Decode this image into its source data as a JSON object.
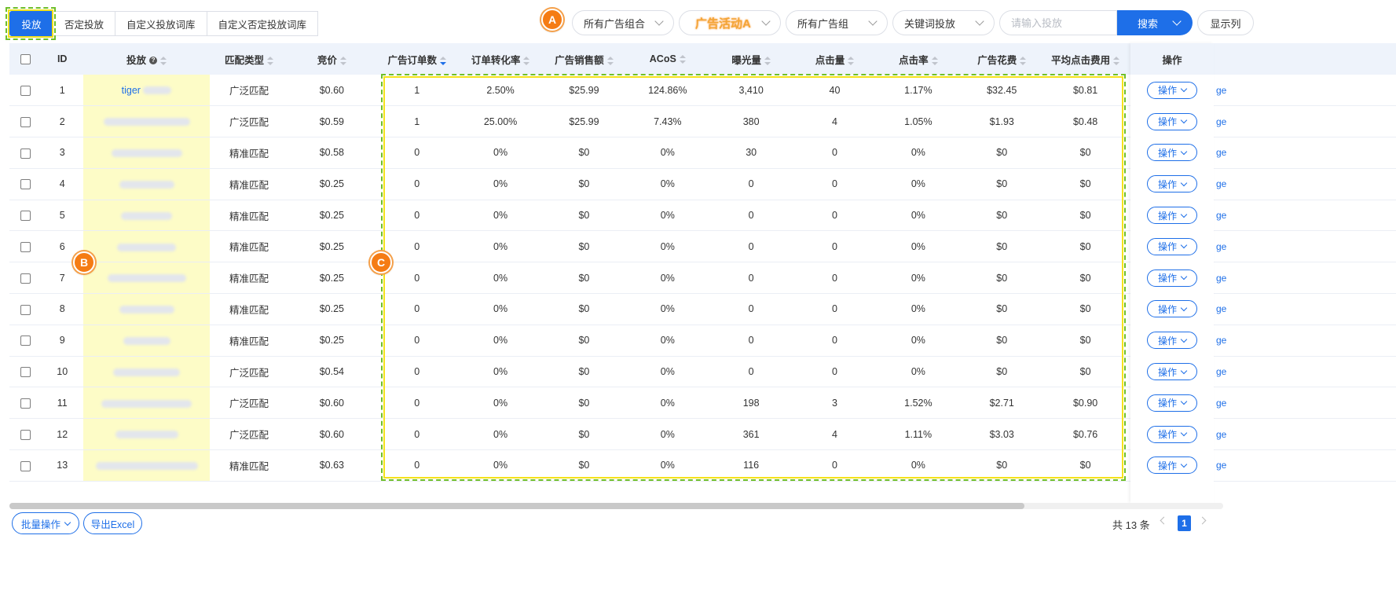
{
  "tabs": [
    {
      "label": "投放",
      "active": true
    },
    {
      "label": "否定投放",
      "active": false
    },
    {
      "label": "自定义投放词库",
      "active": false
    },
    {
      "label": "自定义否定投放词库",
      "active": false
    }
  ],
  "filters": {
    "portfolio": "所有广告组合",
    "campaign": "广告活动A",
    "ad_group": "所有广告组",
    "targeting_type": "关键词投放",
    "search_placeholder": "请输入投放",
    "search_label": "搜索",
    "columns_label": "显示列"
  },
  "markers": {
    "a": "A",
    "b": "B",
    "c": "C"
  },
  "columns": {
    "id": "ID",
    "target": "投放",
    "match_type": "匹配类型",
    "bid": "竞价",
    "orders": "广告订单数",
    "cvr": "订单转化率",
    "sales": "广告销售额",
    "acos": "ACoS",
    "impressions": "曝光量",
    "clicks": "点击量",
    "ctr": "点击率",
    "spend": "广告花费",
    "cpc": "平均点击费用",
    "actions": "操作"
  },
  "rows": [
    {
      "id": "1",
      "keyword": "tiger",
      "match": "广泛匹配",
      "bid": "$0.60",
      "orders": "1",
      "cvr": "2.50%",
      "sales": "$25.99",
      "acos": "124.86%",
      "impressions": "3,410",
      "clicks": "40",
      "ctr": "1.17%",
      "spend": "$32.45",
      "cpc": "$0.81"
    },
    {
      "id": "2",
      "keyword": "",
      "match": "广泛匹配",
      "bid": "$0.59",
      "orders": "1",
      "cvr": "25.00%",
      "sales": "$25.99",
      "acos": "7.43%",
      "impressions": "380",
      "clicks": "4",
      "ctr": "1.05%",
      "spend": "$1.93",
      "cpc": "$0.48"
    },
    {
      "id": "3",
      "keyword": "",
      "match": "精准匹配",
      "bid": "$0.58",
      "orders": "0",
      "cvr": "0%",
      "sales": "$0",
      "acos": "0%",
      "impressions": "30",
      "clicks": "0",
      "ctr": "0%",
      "spend": "$0",
      "cpc": "$0"
    },
    {
      "id": "4",
      "keyword": "",
      "match": "精准匹配",
      "bid": "$0.25",
      "orders": "0",
      "cvr": "0%",
      "sales": "$0",
      "acos": "0%",
      "impressions": "0",
      "clicks": "0",
      "ctr": "0%",
      "spend": "$0",
      "cpc": "$0"
    },
    {
      "id": "5",
      "keyword": "",
      "match": "精准匹配",
      "bid": "$0.25",
      "orders": "0",
      "cvr": "0%",
      "sales": "$0",
      "acos": "0%",
      "impressions": "0",
      "clicks": "0",
      "ctr": "0%",
      "spend": "$0",
      "cpc": "$0"
    },
    {
      "id": "6",
      "keyword": "",
      "match": "精准匹配",
      "bid": "$0.25",
      "orders": "0",
      "cvr": "0%",
      "sales": "$0",
      "acos": "0%",
      "impressions": "0",
      "clicks": "0",
      "ctr": "0%",
      "spend": "$0",
      "cpc": "$0"
    },
    {
      "id": "7",
      "keyword": "",
      "match": "精准匹配",
      "bid": "$0.25",
      "orders": "0",
      "cvr": "0%",
      "sales": "$0",
      "acos": "0%",
      "impressions": "0",
      "clicks": "0",
      "ctr": "0%",
      "spend": "$0",
      "cpc": "$0"
    },
    {
      "id": "8",
      "keyword": "",
      "match": "精准匹配",
      "bid": "$0.25",
      "orders": "0",
      "cvr": "0%",
      "sales": "$0",
      "acos": "0%",
      "impressions": "0",
      "clicks": "0",
      "ctr": "0%",
      "spend": "$0",
      "cpc": "$0"
    },
    {
      "id": "9",
      "keyword": "",
      "match": "精准匹配",
      "bid": "$0.25",
      "orders": "0",
      "cvr": "0%",
      "sales": "$0",
      "acos": "0%",
      "impressions": "0",
      "clicks": "0",
      "ctr": "0%",
      "spend": "$0",
      "cpc": "$0"
    },
    {
      "id": "10",
      "keyword": "",
      "match": "广泛匹配",
      "bid": "$0.54",
      "orders": "0",
      "cvr": "0%",
      "sales": "$0",
      "acos": "0%",
      "impressions": "0",
      "clicks": "0",
      "ctr": "0%",
      "spend": "$0",
      "cpc": "$0"
    },
    {
      "id": "11",
      "keyword": "",
      "match": "广泛匹配",
      "bid": "$0.60",
      "orders": "0",
      "cvr": "0%",
      "sales": "$0",
      "acos": "0%",
      "impressions": "198",
      "clicks": "3",
      "ctr": "1.52%",
      "spend": "$2.71",
      "cpc": "$0.90"
    },
    {
      "id": "12",
      "keyword": "",
      "match": "广泛匹配",
      "bid": "$0.60",
      "orders": "0",
      "cvr": "0%",
      "sales": "$0",
      "acos": "0%",
      "impressions": "361",
      "clicks": "4",
      "ctr": "1.11%",
      "spend": "$3.03",
      "cpc": "$0.76"
    },
    {
      "id": "13",
      "keyword": "",
      "match": "精准匹配",
      "bid": "$0.63",
      "orders": "0",
      "cvr": "0%",
      "sales": "$0",
      "acos": "0%",
      "impressions": "116",
      "clicks": "0",
      "ctr": "0%",
      "spend": "$0",
      "cpc": "$0"
    }
  ],
  "row_action_label": "操作",
  "row_trailing_text": "ge",
  "footer": {
    "bulk_label": "批量操作",
    "export_label": "导出Excel",
    "total_text": "共 13 条",
    "current_page": "1"
  },
  "colors": {
    "primary": "#1e6fe8",
    "highlight": "#fdfcc7",
    "marker": "#f57c14",
    "frame": "#6fbf2a"
  }
}
